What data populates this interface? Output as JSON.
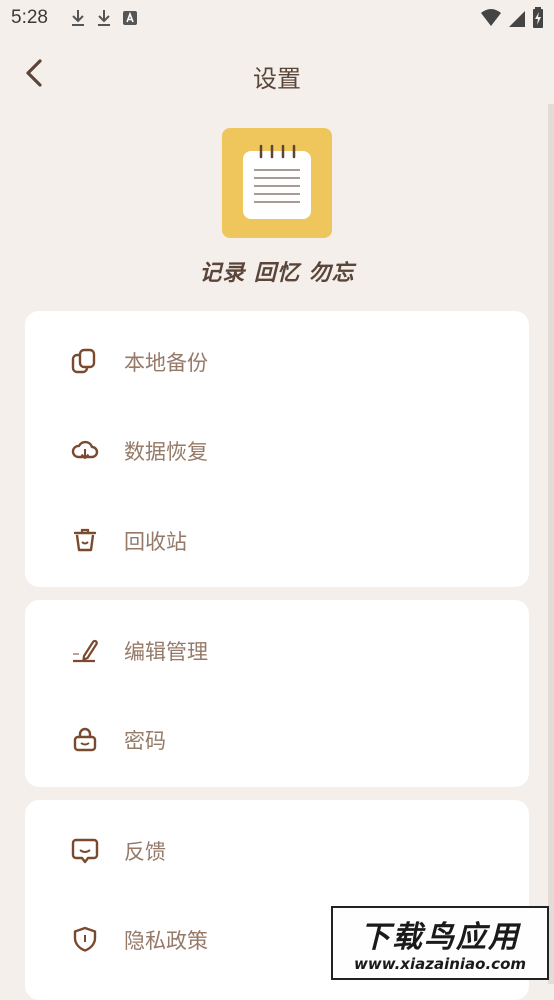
{
  "status_bar": {
    "time": "5:28"
  },
  "app_bar": {
    "title": "设置"
  },
  "header": {
    "tagline": "记录 回忆 勿忘"
  },
  "groups": [
    {
      "items": [
        {
          "label": "本地备份",
          "icon": "copy-icon"
        },
        {
          "label": "数据恢复",
          "icon": "cloud-icon"
        },
        {
          "label": "回收站",
          "icon": "trash-icon"
        }
      ]
    },
    {
      "items": [
        {
          "label": "编辑管理",
          "icon": "pen-icon"
        },
        {
          "label": "密码",
          "icon": "lock-icon"
        }
      ]
    },
    {
      "items": [
        {
          "label": "反馈",
          "icon": "chat-icon"
        },
        {
          "label": "隐私政策",
          "icon": "shield-icon"
        }
      ]
    }
  ],
  "watermark": {
    "title": "下载鸟应用",
    "url": "www.xiazainiao.com"
  },
  "colors": {
    "background": "#f5efec",
    "card": "#ffffff",
    "accent": "#eec65c",
    "icon": "#7a4a2e",
    "label": "#967a69"
  }
}
